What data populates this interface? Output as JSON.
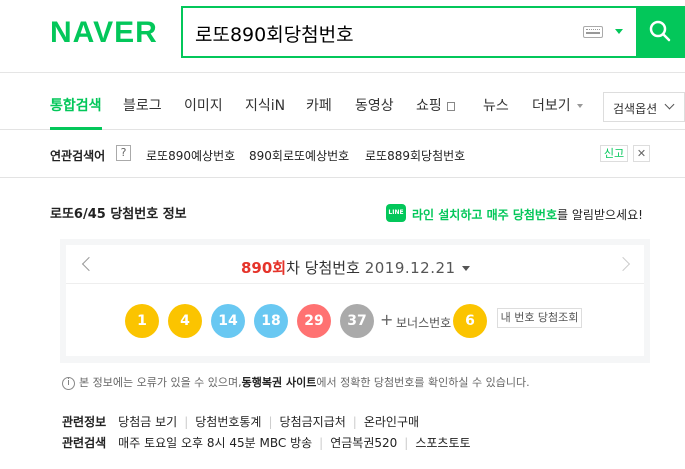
{
  "header": {
    "logo": "NAVER",
    "search_value": "로또890회당첨번호",
    "brand_color": "#03c75a"
  },
  "tabs": [
    {
      "label": "통합검색",
      "active": true
    },
    {
      "label": "블로그"
    },
    {
      "label": "이미지"
    },
    {
      "label": "지식iN"
    },
    {
      "label": "카페"
    },
    {
      "label": "동영상"
    },
    {
      "label": "쇼핑"
    },
    {
      "label": "뉴스"
    },
    {
      "label": "더보기"
    }
  ],
  "search_options_label": "검색옵션",
  "related": {
    "title": "연관검색어",
    "help": "?",
    "links": [
      "로또890예상번호",
      "890회로또예상번호",
      "로또889회당첨번호"
    ],
    "report_label": "신고",
    "close_label": "✕"
  },
  "lotto": {
    "section_title": "로또6/45 당첨번호 정보",
    "line_icon": "LINE",
    "line_promo_hl": "라인 설치하고 매주 당첨번호",
    "line_promo_rest": "를 알림받으세요!",
    "round": "890회",
    "round_suffix": "차 당첨번호",
    "date": "2019.12.21",
    "numbers": [
      {
        "n": "1",
        "color": "#fbc400"
      },
      {
        "n": "4",
        "color": "#fbc400"
      },
      {
        "n": "14",
        "color": "#69c8f2"
      },
      {
        "n": "18",
        "color": "#69c8f2"
      },
      {
        "n": "29",
        "color": "#ff7272"
      },
      {
        "n": "37",
        "color": "#aaaaaa"
      }
    ],
    "plus": "+",
    "bonus_label": "보너스번호",
    "bonus": {
      "n": "6",
      "color": "#fbc400"
    },
    "check_button": "내 번호 당첨조회"
  },
  "notice": {
    "icon": "i",
    "pre": "본 정보에는 오류가 있을 수 있으며,",
    "link": "동행복권 사이트",
    "post": "에서 정확한 당첨번호를 확인하실 수 있습니다."
  },
  "related_info": {
    "label": "관련정보",
    "items": [
      "당첨금 보기",
      "당첨번호통계",
      "당첨금지급처",
      "온라인구매"
    ]
  },
  "related_search": {
    "label": "관련검색",
    "items": [
      "매주 토요일 오후 8시 45분 MBC 방송",
      "연금복권520",
      "스포츠토토"
    ]
  }
}
